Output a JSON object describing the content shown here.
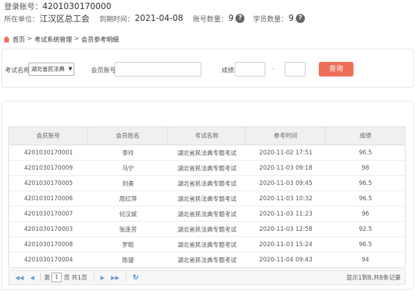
{
  "account": {
    "label": "登录账号：",
    "value": "4201030170000"
  },
  "unit": {
    "label": "所在单位：",
    "value": "江汉区总工会",
    "expire_label": "到期时间：",
    "expire_value": "2021-04-08",
    "account_count_label": "账号数量：",
    "account_count": "9",
    "student_count_label": "学员数量：",
    "student_count": "9",
    "help_icon": "question-circle-icon"
  },
  "breadcrumb": {
    "home": "首页",
    "sep": ">",
    "level2": "考试系统管理",
    "level3": "会员参考明细"
  },
  "search": {
    "exam_label": "考试名称",
    "exam_selected": "湖北省民法典",
    "member_label": "会员账号",
    "score_label": "成绩",
    "range_sep": "-",
    "query_button": "查询"
  },
  "table": {
    "headers": [
      "会员账号",
      "会员姓名",
      "考试名称",
      "参考时间",
      "成绩"
    ],
    "rows": [
      [
        "4201030170001",
        "李玲",
        "湖北省民法典专题考试",
        "2020-11-02 17:51",
        "96.5"
      ],
      [
        "4201030170009",
        "马宁",
        "湖北省民法典专题考试",
        "2020-11-03 09:18",
        "98"
      ],
      [
        "4201030170005",
        "刘勇",
        "湖北省民法典专题考试",
        "2020-11-03 09:45",
        "96.5"
      ],
      [
        "4201030170006",
        "周红萍",
        "湖北省民法典专题考试",
        "2020-11-03 10:32",
        "96.5"
      ],
      [
        "4201030170007",
        "何汉斌",
        "湖北省民法典专题考试",
        "2020-11-03 11:23",
        "96"
      ],
      [
        "4201030170003",
        "张连芳",
        "湖北省民法典专题考试",
        "2020-11-03 12:58",
        "92.5"
      ],
      [
        "4201030170008",
        "罗聪",
        "湖北省民法典专题考试",
        "2020-11-03 15:24",
        "96.5"
      ],
      [
        "4201030170004",
        "陈捷",
        "湖北省民法典专题考试",
        "2020-11-04 09:43",
        "94"
      ]
    ]
  },
  "pager": {
    "first": "◀◀",
    "prev": "◀",
    "page_prefix": "第",
    "page_value": "1",
    "page_suffix": "页 共1页",
    "next": "▶",
    "last": "▶▶",
    "refresh": "↻",
    "summary": "显示1到8,共8条记录"
  }
}
